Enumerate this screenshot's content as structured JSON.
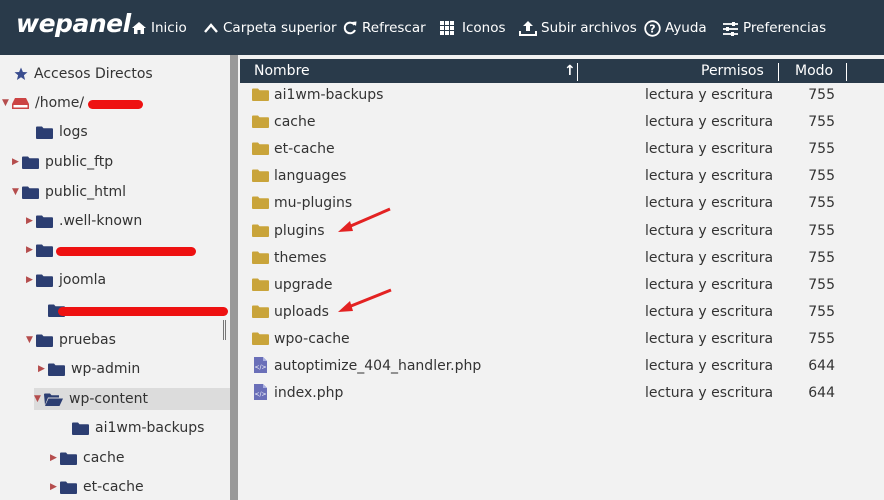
{
  "brand": "wepanel",
  "toolbar": [
    {
      "icon": "home-icon",
      "label": "Inicio"
    },
    {
      "icon": "chevron-up-icon",
      "label": "Carpeta superior"
    },
    {
      "icon": "refresh-icon",
      "label": "Refrescar"
    },
    {
      "icon": "grid-icon",
      "label": "Iconos"
    },
    {
      "icon": "upload-icon",
      "label": "Subir archivos"
    },
    {
      "icon": "help-icon",
      "label": "Ayuda"
    },
    {
      "icon": "sliders-icon",
      "label": "Preferencias"
    }
  ],
  "sidebar": {
    "shortcuts_label": "Accesos Directos",
    "tree": [
      {
        "label": "/home/",
        "expanded": true,
        "redacted": true
      },
      {
        "label": "logs"
      },
      {
        "label": "public_ftp",
        "expanded": false
      },
      {
        "label": "public_html",
        "expanded": true
      },
      {
        "label": ".well-known",
        "expanded": false
      },
      {
        "label": "",
        "expanded": false,
        "redacted": true
      },
      {
        "label": "joomla",
        "expanded": false
      },
      {
        "label": "",
        "redacted": true
      },
      {
        "label": "pruebas",
        "expanded": true
      },
      {
        "label": "wp-admin",
        "expanded": false
      },
      {
        "label": "wp-content",
        "expanded": true,
        "selected": true
      },
      {
        "label": "ai1wm-backups"
      },
      {
        "label": "cache",
        "expanded": false
      },
      {
        "label": "et-cache",
        "expanded": false
      }
    ]
  },
  "table": {
    "headers": {
      "name": "Nombre",
      "permissions": "Permisos",
      "mode": "Modo"
    },
    "rows": [
      {
        "type": "folder",
        "name": "ai1wm-backups",
        "permissions": "lectura y escritura",
        "mode": "755"
      },
      {
        "type": "folder",
        "name": "cache",
        "permissions": "lectura y escritura",
        "mode": "755"
      },
      {
        "type": "folder",
        "name": "et-cache",
        "permissions": "lectura y escritura",
        "mode": "755"
      },
      {
        "type": "folder",
        "name": "languages",
        "permissions": "lectura y escritura",
        "mode": "755"
      },
      {
        "type": "folder",
        "name": "mu-plugins",
        "permissions": "lectura y escritura",
        "mode": "755"
      },
      {
        "type": "folder",
        "name": "plugins",
        "permissions": "lectura y escritura",
        "mode": "755",
        "annotated": true
      },
      {
        "type": "folder",
        "name": "themes",
        "permissions": "lectura y escritura",
        "mode": "755"
      },
      {
        "type": "folder",
        "name": "upgrade",
        "permissions": "lectura y escritura",
        "mode": "755"
      },
      {
        "type": "folder",
        "name": "uploads",
        "permissions": "lectura y escritura",
        "mode": "755",
        "annotated": true
      },
      {
        "type": "folder",
        "name": "wpo-cache",
        "permissions": "lectura y escritura",
        "mode": "755"
      },
      {
        "type": "file",
        "name": "autoptimize_404_handler.php",
        "permissions": "lectura y escritura",
        "mode": "644"
      },
      {
        "type": "file",
        "name": "index.php",
        "permissions": "lectura y escritura",
        "mode": "644"
      }
    ]
  },
  "colors": {
    "topbar": "#293a4a",
    "folder": "#c9a43a",
    "folder_dark": "#2c3e72",
    "annotation": "#e32222"
  }
}
